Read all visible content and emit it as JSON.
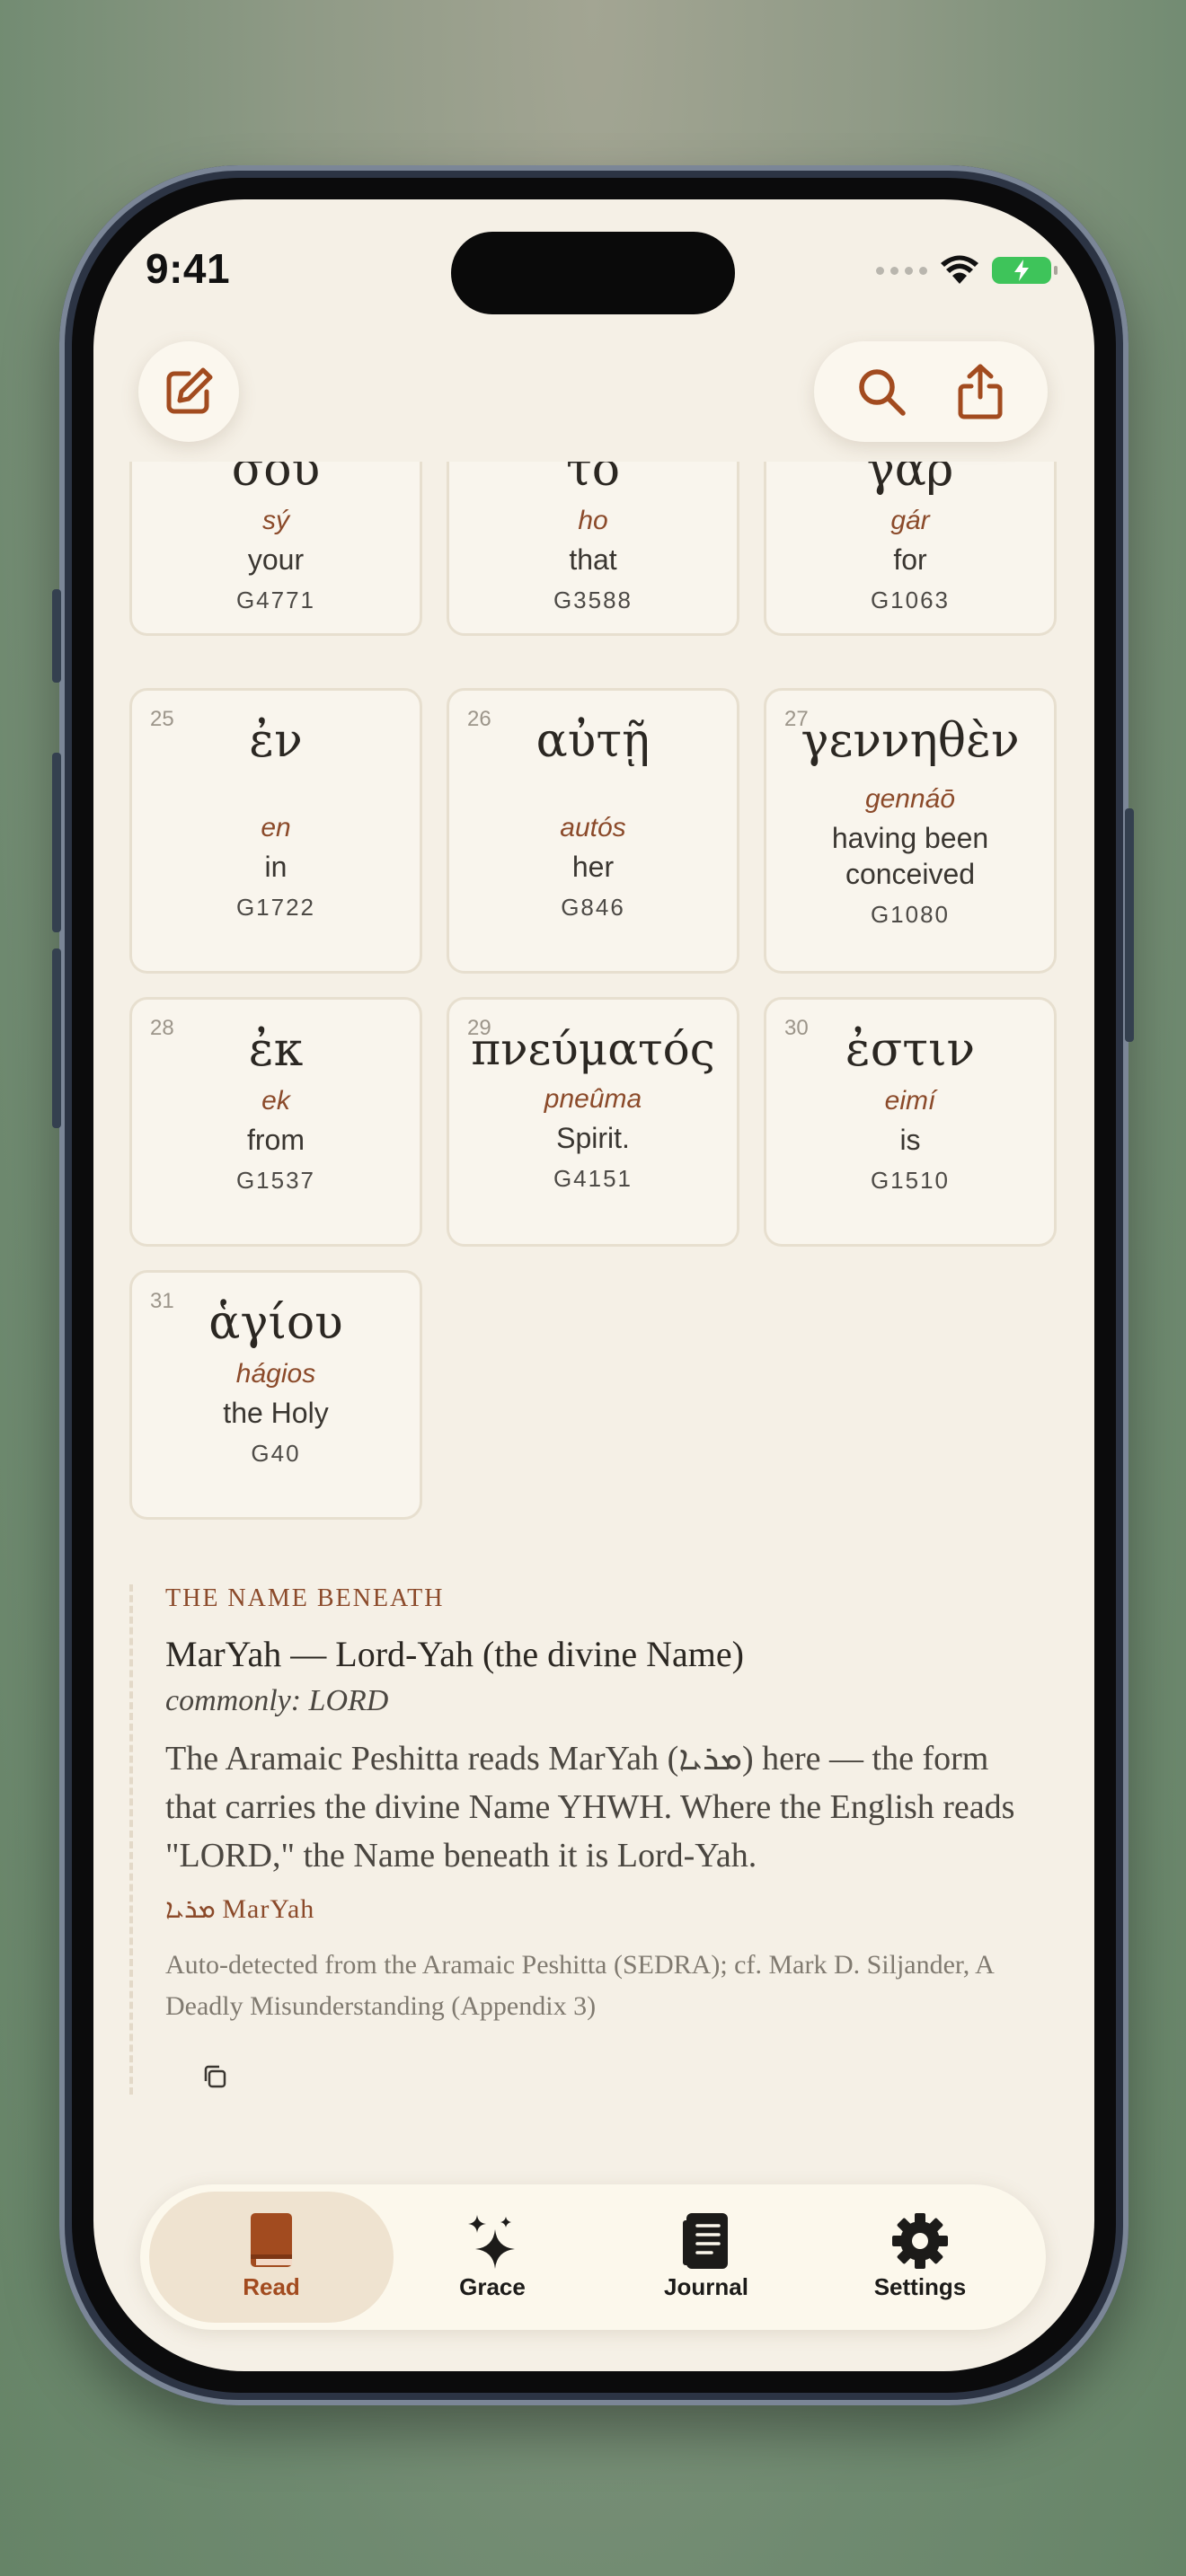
{
  "status_bar": {
    "time": "9:41"
  },
  "cards": [
    {
      "number": "",
      "greek": "σου",
      "translit": "sý",
      "gloss": "your",
      "strong": "G4771"
    },
    {
      "number": "",
      "greek": "τὸ",
      "translit": "ho",
      "gloss": "that",
      "strong": "G3588"
    },
    {
      "number": "",
      "greek": "γάρ",
      "translit": "gár",
      "gloss": "for",
      "strong": "G1063"
    },
    {
      "number": "25",
      "greek": "ἐν",
      "translit": "en",
      "gloss": "in",
      "strong": "G1722"
    },
    {
      "number": "26",
      "greek": "αὐτῇ",
      "translit": "autós",
      "gloss": "her",
      "strong": "G846"
    },
    {
      "number": "27",
      "greek": "γεννηθὲν",
      "translit": "gennáō",
      "gloss": "having been conceived",
      "strong": "G1080"
    },
    {
      "number": "28",
      "greek": "ἐκ",
      "translit": "ek",
      "gloss": "from",
      "strong": "G1537"
    },
    {
      "number": "29",
      "greek": "πνεύματός",
      "translit": "pneûma",
      "gloss": "Spirit.",
      "strong": "G4151"
    },
    {
      "number": "30",
      "greek": "ἐστιν",
      "translit": "eimí",
      "gloss": "is",
      "strong": "G1510"
    },
    {
      "number": "31",
      "greek": "ἁγίου",
      "translit": "hágios",
      "gloss": "the Holy",
      "strong": "G40"
    }
  ],
  "note": {
    "label": "THE NAME BENEATH",
    "title": "MarYah — Lord-Yah (the divine Name)",
    "commonly": "commonly: LORD",
    "body": "The Aramaic Peshitta reads MarYah (ܡܪܝܐ) here — the form that carries the divine Name YHWH. Where the English reads \"LORD,\" the Name beneath it is Lord-Yah.",
    "term": "ܡܪܝܐ MarYah",
    "source": "Auto-detected from the Aramaic Peshitta (SEDRA); cf. Mark D. Siljander, A Deadly Misunderstanding (Appendix 3)"
  },
  "tabs": [
    {
      "label": "Read",
      "icon": "book-icon",
      "active": true
    },
    {
      "label": "Grace",
      "icon": "sparkles-icon",
      "active": false
    },
    {
      "label": "Journal",
      "icon": "journal-icon",
      "active": false
    },
    {
      "label": "Settings",
      "icon": "gear-icon",
      "active": false
    }
  ],
  "colors": {
    "accent": "#a24b1f",
    "background": "#f5f0e6",
    "card": "#f9f5ed"
  }
}
